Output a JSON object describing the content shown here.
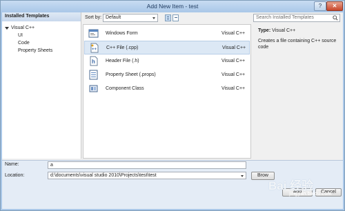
{
  "window": {
    "title": "Add New Item - test",
    "help_label": "?",
    "close_label": "✕"
  },
  "sidebar": {
    "header": "Installed Templates",
    "root": "Visual C++",
    "children": [
      "UI",
      "Code",
      "Property Sheets"
    ]
  },
  "toolbar": {
    "sort_label": "Sort by:",
    "sort_value": "Default",
    "search_placeholder": "Search Installed Templates"
  },
  "templates": [
    {
      "name": "Windows Form",
      "type": "Visual C++",
      "icon": "windows-form-icon"
    },
    {
      "name": "C++ File (.cpp)",
      "type": "Visual C++",
      "icon": "cpp-file-icon",
      "selected": true
    },
    {
      "name": "Header File (.h)",
      "type": "Visual C++",
      "icon": "header-file-icon"
    },
    {
      "name": "Property Sheet (.props)",
      "type": "Visual C++",
      "icon": "property-sheet-icon"
    },
    {
      "name": "Component Class",
      "type": "Visual C++",
      "icon": "component-class-icon"
    }
  ],
  "info": {
    "type_label": "Type:",
    "type_value": "Visual C++",
    "description": "Creates a file containing C++ source code"
  },
  "form": {
    "name_label": "Name:",
    "name_value": "a",
    "location_label": "Location:",
    "location_value": "d:\\documents\\visual studio 2010\\Projects\\test\\test",
    "browse_label": "Brow",
    "add_label": "Add",
    "cancel_label": "Cancel"
  },
  "watermark": {
    "text": "Bai 经验",
    "sub": "jingyan.baidu.com"
  },
  "colors": {
    "title_bar": "#a9c7e8",
    "selection": "#dce8f5",
    "body": "#f0f0f0"
  }
}
